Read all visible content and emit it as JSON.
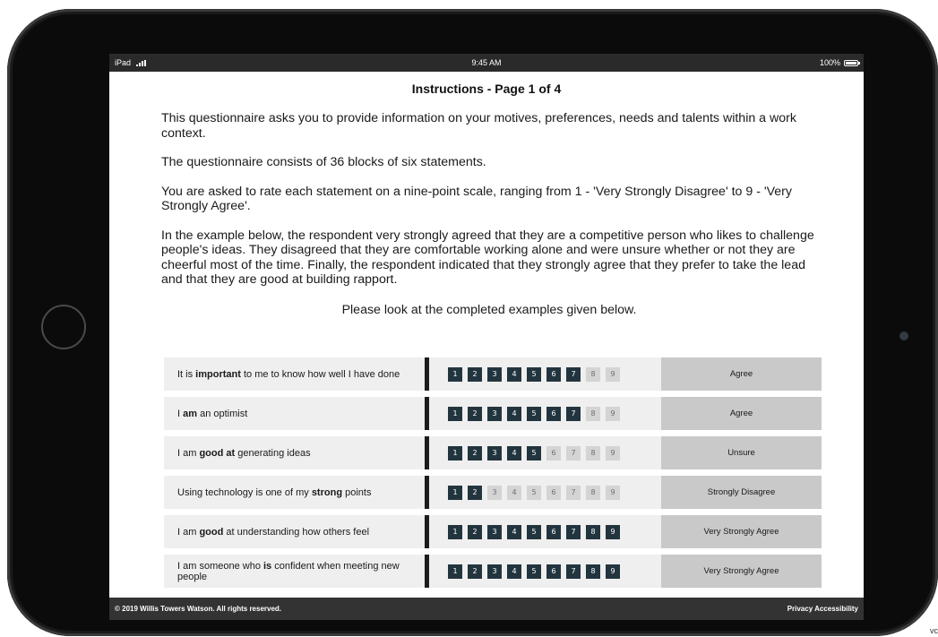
{
  "status": {
    "device": "iPad",
    "time": "9:45 AM",
    "battery": "100%"
  },
  "page_title": "Instructions - Page 1 of 4",
  "paragraphs": {
    "p1": "This questionnaire asks you to provide information on your motives, preferences, needs and talents within a work context.",
    "p2": "The questionnaire consists of 36 blocks of six statements.",
    "p3": "You are asked to rate each statement on a nine-point scale, ranging from 1 - 'Very Strongly Disagree' to 9 - 'Very Strongly Agree'.",
    "p4": "In the example below, the respondent very strongly agreed that they are a competitive person who likes to challenge people's ideas. They disagreed that they are comfortable working alone and were unsure whether or not they are cheerful most of the time. Finally, the respondent indicated that they strongly agree that they prefer to take the lead and that they are good at building rapport.",
    "p5": "Please look at the completed examples given below."
  },
  "scale_numbers": [
    "1",
    "2",
    "3",
    "4",
    "5",
    "6",
    "7",
    "8",
    "9"
  ],
  "examples": [
    {
      "before": "It is ",
      "bold": "important",
      "after": " to me to know how well I have done",
      "rating": 7,
      "answer": "Agree"
    },
    {
      "before": "I ",
      "bold": "am",
      "after": " an optimist",
      "rating": 7,
      "answer": "Agree"
    },
    {
      "before": "I am ",
      "bold": "good at",
      "after": " generating ideas",
      "rating": 5,
      "answer": "Unsure"
    },
    {
      "before": "Using technology is one of my ",
      "bold": "strong",
      "after": " points",
      "rating": 2,
      "answer": "Strongly Disagree"
    },
    {
      "before": "I am ",
      "bold": "good",
      "after": " at understanding how others feel",
      "rating": 9,
      "answer": "Very Strongly Agree"
    },
    {
      "before": "I am someone who ",
      "bold": "is",
      "after": " confident when meeting new people",
      "rating": 9,
      "answer": "Very Strongly Agree"
    }
  ],
  "footer": {
    "copyright": "© 2019 Willis Towers Watson. All rights reserved.",
    "links": "Privacy Accessibility"
  },
  "corner_text": "vc",
  "colors": {
    "selected": "#22353f",
    "unselected": "#d4d4d4",
    "answer_bg": "#c9c9c9"
  }
}
